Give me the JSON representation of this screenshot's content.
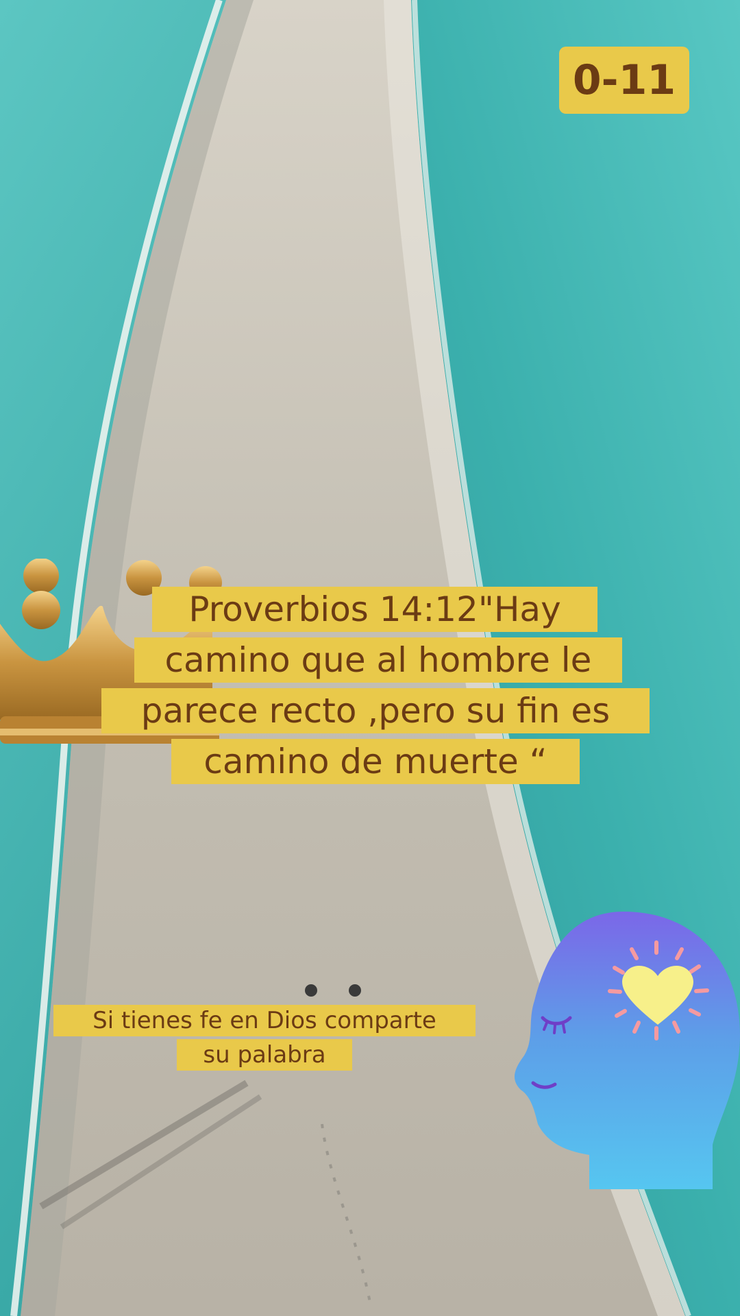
{
  "counter": "0-11",
  "verse": {
    "lines": [
      "Proverbios 14:12\"Hay",
      "camino que al hombre le",
      "parece recto ,pero su fin es",
      "camino de muerte “"
    ]
  },
  "prompt": {
    "lines": [
      "Si tienes fe en Dios comparte",
      "su palabra"
    ]
  },
  "stickers": {
    "crown": "crown-icon",
    "head": "mindful-head-heart-icon"
  },
  "colors": {
    "caption_bg": "#e9c94a",
    "caption_text": "#6b3b14",
    "sea": "#3fb3ae",
    "sand": "#c9c3b6"
  }
}
